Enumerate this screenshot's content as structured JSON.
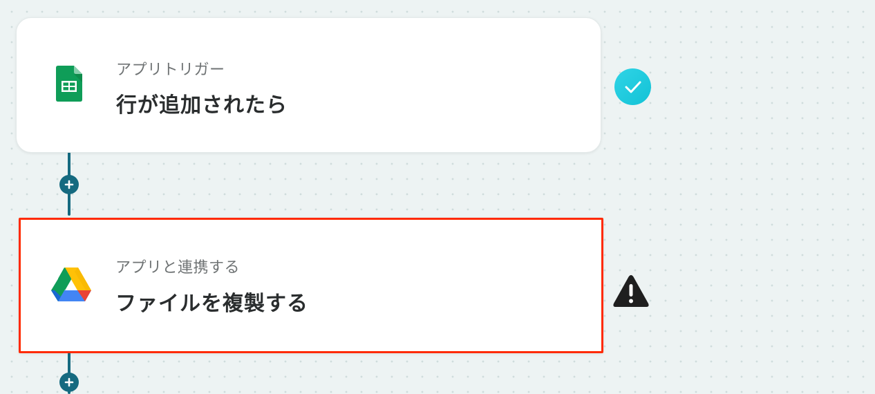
{
  "flow": {
    "steps": [
      {
        "type_label": "アプリトリガー",
        "title": "行が追加されたら",
        "app_icon": "google-sheets-icon",
        "status_icon": "check-circle-icon"
      },
      {
        "type_label": "アプリと連携する",
        "title": "ファイルを複製する",
        "app_icon": "google-drive-icon",
        "status_icon": "warning-icon"
      }
    ]
  },
  "colors": {
    "connector": "#156a80",
    "highlight_border": "#ff2a00",
    "check_badge": "#1ec9dc",
    "warning": "#1f1f1f"
  }
}
